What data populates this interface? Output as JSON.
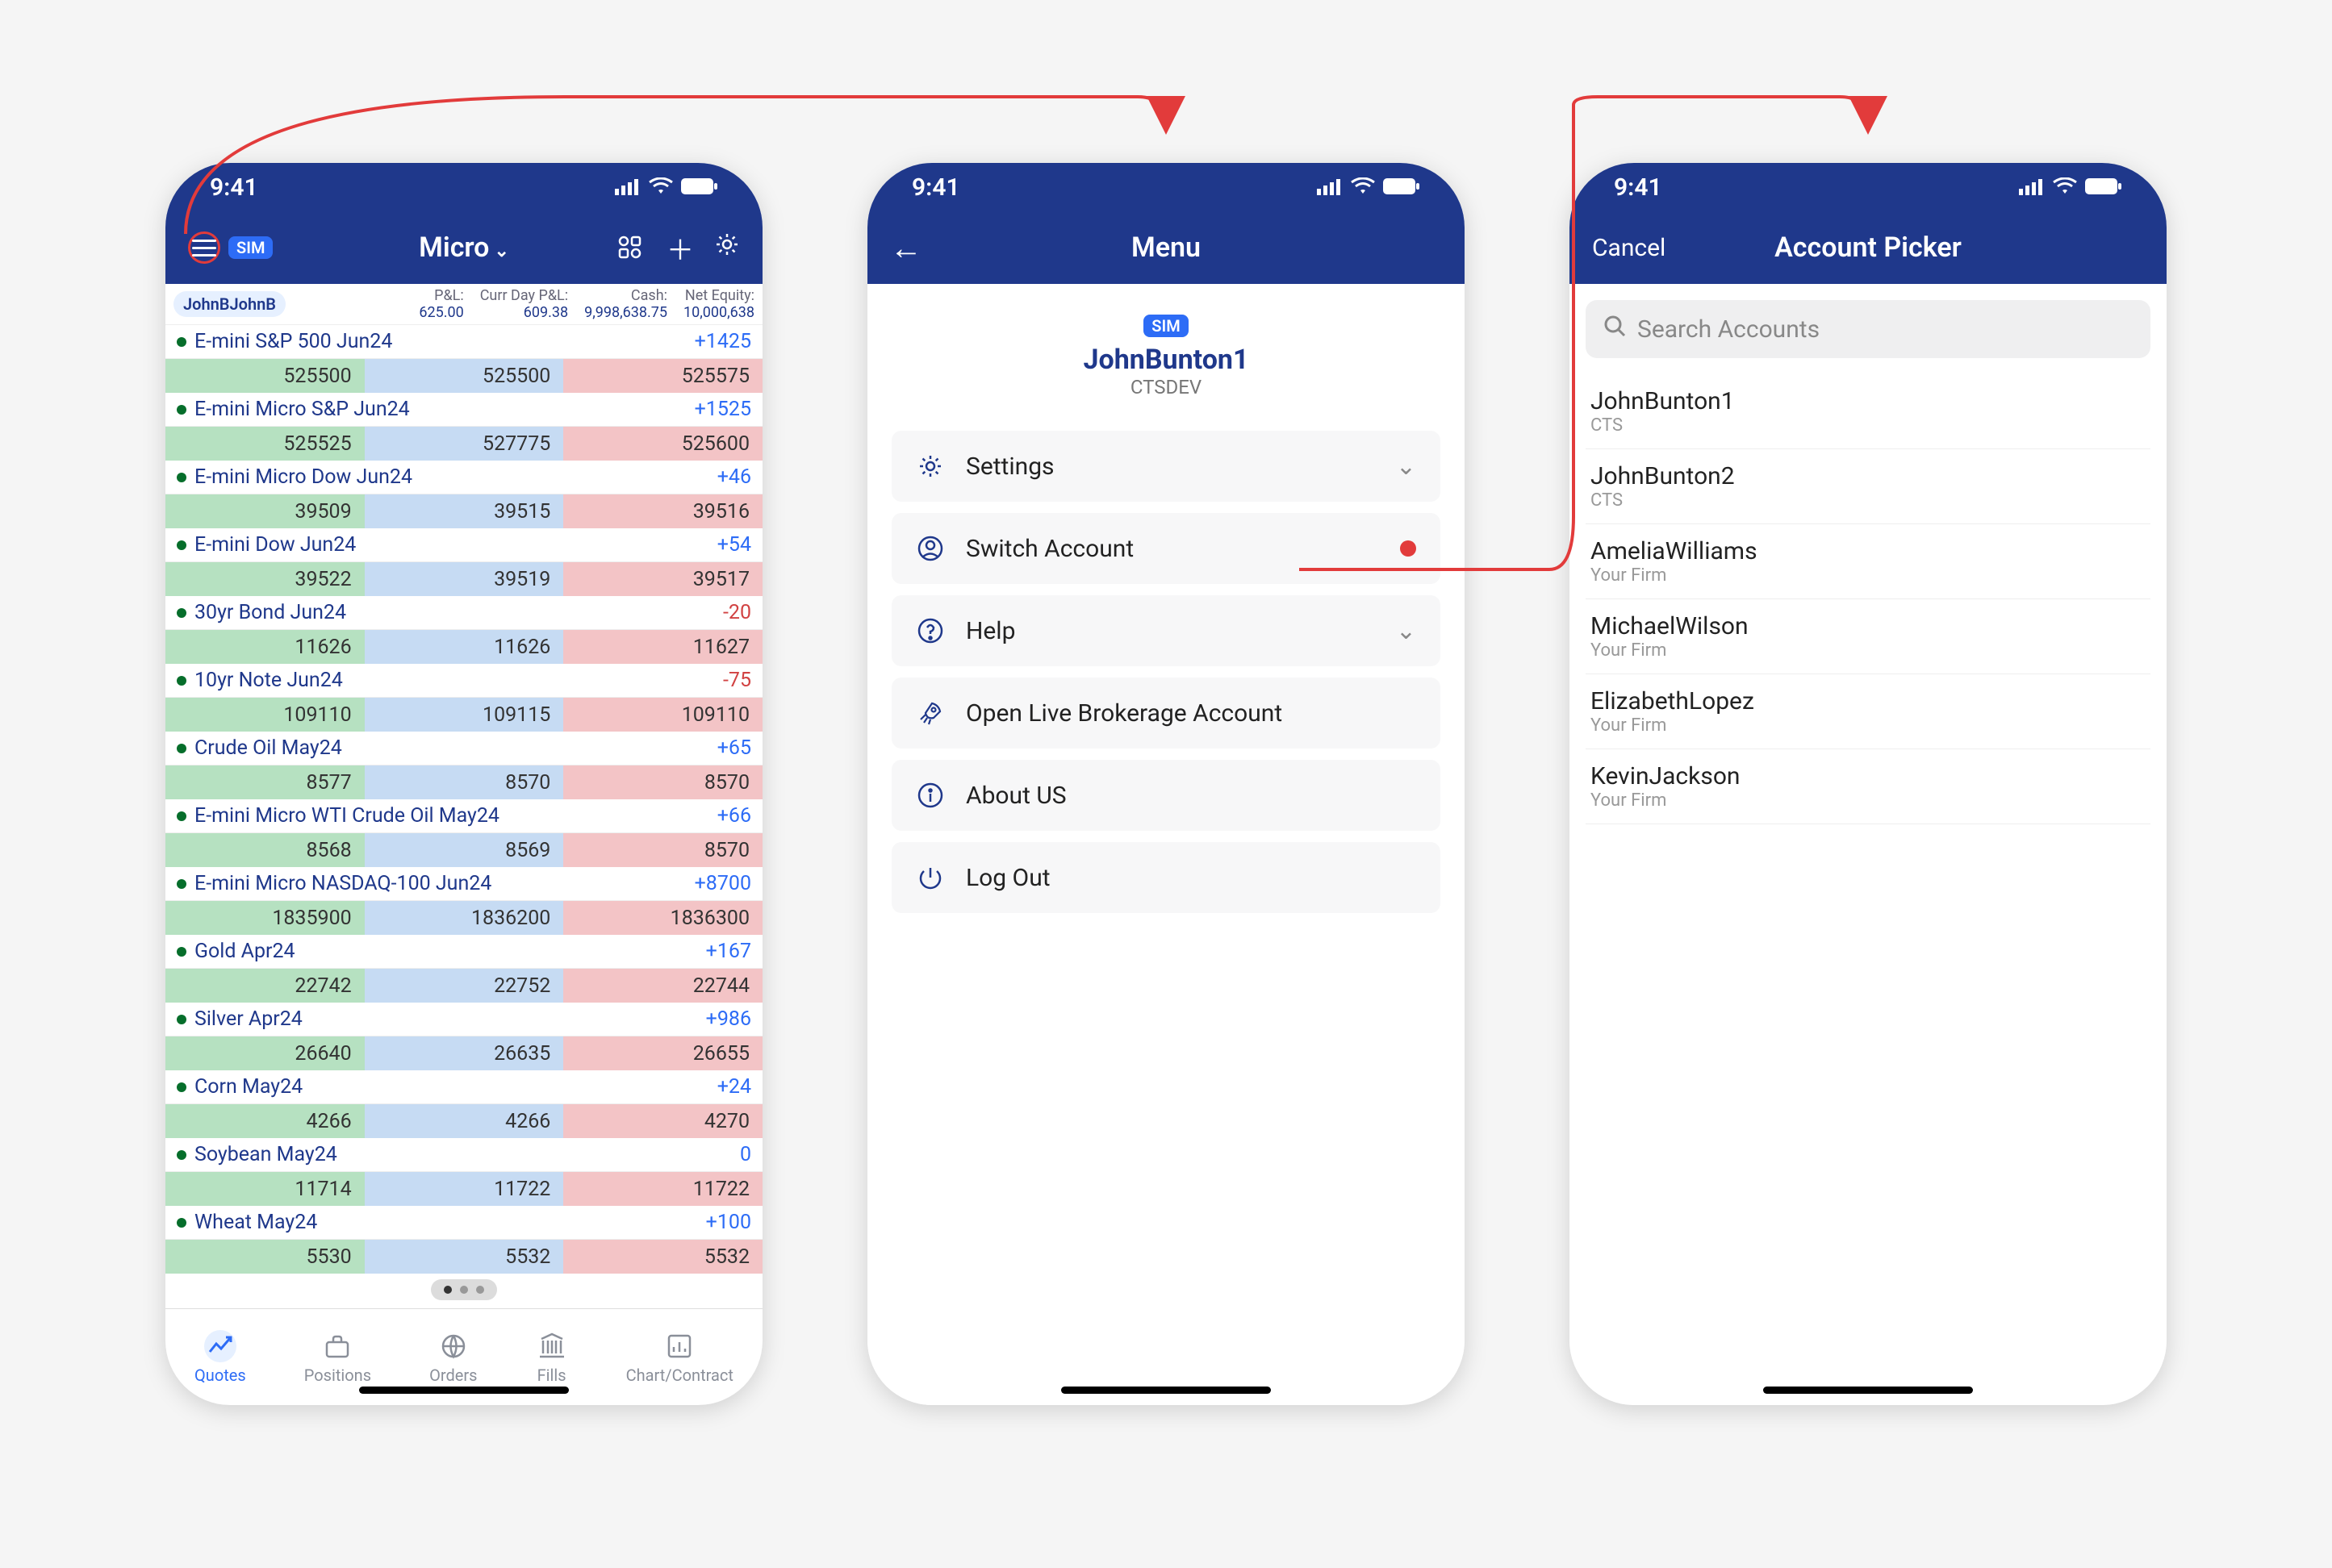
{
  "status_time": "9:41",
  "phone1": {
    "sim": "SIM",
    "title": "Micro",
    "account_pill": "JohnBJohnB",
    "summary": [
      {
        "label": "P&L:",
        "value": "625.00"
      },
      {
        "label": "Curr Day P&L:",
        "value": "609.38"
      },
      {
        "label": "Cash:",
        "value": "9,998,638.75"
      },
      {
        "label": "Net Equity:",
        "value": "10,000,638"
      }
    ],
    "rows": [
      {
        "name": "E-mini S&P 500 Jun24",
        "change": "+1425",
        "sign": "pos",
        "last": "525500",
        "bid": "525500",
        "ask": "525575"
      },
      {
        "name": "E-mini Micro S&P Jun24",
        "change": "+1525",
        "sign": "pos",
        "last": "525525",
        "bid": "527775",
        "ask": "525600"
      },
      {
        "name": "E-mini Micro Dow Jun24",
        "change": "+46",
        "sign": "pos",
        "last": "39509",
        "bid": "39515",
        "ask": "39516"
      },
      {
        "name": "E-mini Dow Jun24",
        "change": "+54",
        "sign": "pos",
        "last": "39522",
        "bid": "39519",
        "ask": "39517"
      },
      {
        "name": "30yr Bond Jun24",
        "change": "-20",
        "sign": "neg",
        "last": "11626",
        "bid": "11626",
        "ask": "11627"
      },
      {
        "name": "10yr Note Jun24",
        "change": "-75",
        "sign": "neg",
        "last": "109110",
        "bid": "109115",
        "ask": "109110"
      },
      {
        "name": "Crude Oil May24",
        "change": "+65",
        "sign": "pos",
        "last": "8577",
        "bid": "8570",
        "ask": "8570"
      },
      {
        "name": "E-mini Micro WTI Crude Oil May24",
        "change": "+66",
        "sign": "pos",
        "last": "8568",
        "bid": "8569",
        "ask": "8570"
      },
      {
        "name": "E-mini Micro NASDAQ-100 Jun24",
        "change": "+8700",
        "sign": "pos",
        "last": "1835900",
        "bid": "1836200",
        "ask": "1836300"
      },
      {
        "name": "Gold Apr24",
        "change": "+167",
        "sign": "pos",
        "last": "22742",
        "bid": "22752",
        "ask": "22744"
      },
      {
        "name": "Silver Apr24",
        "change": "+986",
        "sign": "pos",
        "last": "26640",
        "bid": "26635",
        "ask": "26655"
      },
      {
        "name": "Corn May24",
        "change": "+24",
        "sign": "pos",
        "last": "4266",
        "bid": "4266",
        "ask": "4270"
      },
      {
        "name": "Soybean May24",
        "change": "0",
        "sign": "zero",
        "last": "11714",
        "bid": "11722",
        "ask": "11722"
      },
      {
        "name": "Wheat May24",
        "change": "+100",
        "sign": "pos",
        "last": "5530",
        "bid": "5532",
        "ask": "5532"
      }
    ],
    "tabs": [
      {
        "label": "Quotes",
        "active": true
      },
      {
        "label": "Positions",
        "active": false
      },
      {
        "label": "Orders",
        "active": false
      },
      {
        "label": "Fills",
        "active": false
      },
      {
        "label": "Chart/Contract",
        "active": false
      }
    ]
  },
  "phone2": {
    "title": "Menu",
    "sim": "SIM",
    "user_name": "JohnBunton1",
    "user_firm": "CTSDEV",
    "menu_settings": "Settings",
    "menu_switch": "Switch Account",
    "menu_help": "Help",
    "menu_open": "Open Live Brokerage Account",
    "menu_about": "About US",
    "menu_logout": "Log Out"
  },
  "phone3": {
    "cancel": "Cancel",
    "title": "Account Picker",
    "search_placeholder": "Search Accounts",
    "accounts": [
      {
        "name": "JohnBunton1",
        "firm": "CTS"
      },
      {
        "name": "JohnBunton2",
        "firm": "CTS"
      },
      {
        "name": "AmeliaWilliams",
        "firm": "Your Firm"
      },
      {
        "name": "MichaelWilson",
        "firm": "Your Firm"
      },
      {
        "name": "ElizabethLopez",
        "firm": "Your Firm"
      },
      {
        "name": "KevinJackson",
        "firm": "Your Firm"
      }
    ]
  }
}
